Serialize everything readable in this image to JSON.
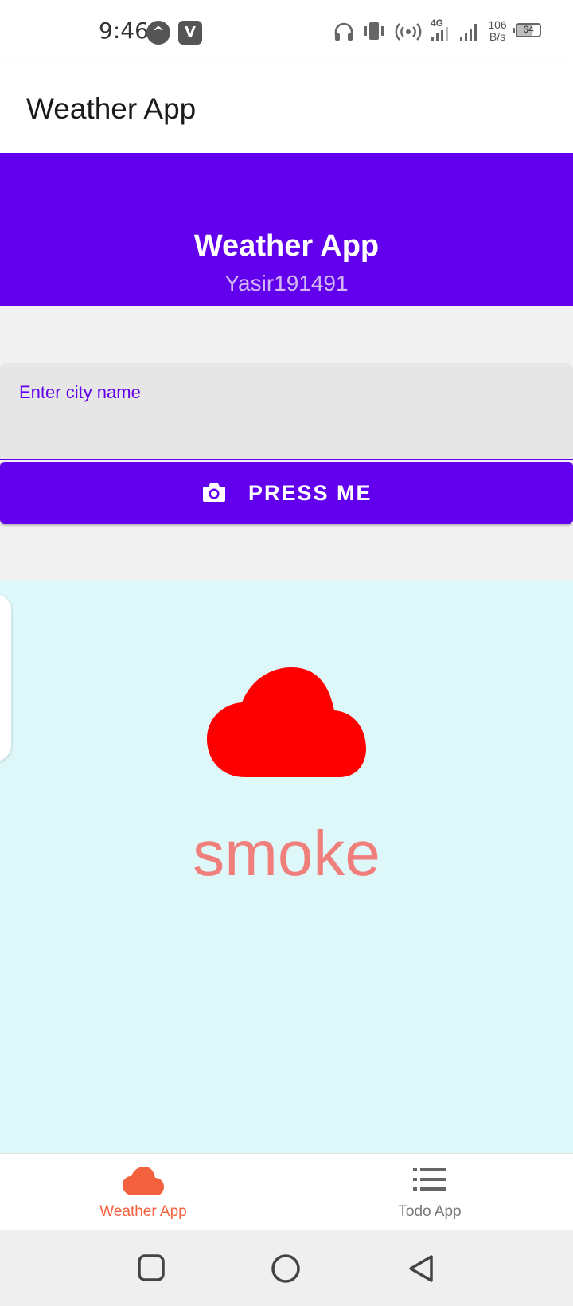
{
  "status_bar": {
    "time": "9:46",
    "app_icons": [
      "^",
      "V"
    ],
    "net_speed_value": "106",
    "net_speed_unit": "B/s",
    "network_type": "4G",
    "battery_level": "64",
    "icons": [
      "headphones-icon",
      "vibrate-icon",
      "hotspot-icon",
      "signal-4g-icon",
      "signal-icon",
      "battery-icon"
    ]
  },
  "app_bar": {
    "title": "Weather App"
  },
  "header": {
    "title": "Weather App",
    "subtitle": "Yasir191491",
    "background_color": "#6200ee"
  },
  "search": {
    "label": "Enter city name",
    "value": "",
    "accent_color": "#6200ee"
  },
  "action_button": {
    "icon": "camera-icon",
    "label": "PRESS ME",
    "color": "#6200ee"
  },
  "weather": {
    "icon": "cloud-icon",
    "icon_color": "#ff0000",
    "condition": "smoke",
    "text_color": "#f07f7b",
    "background_color": "#def7f9"
  },
  "bottom_nav": {
    "active_color": "#f4613f",
    "inactive_color": "#777777",
    "tabs": [
      {
        "label": "Weather App",
        "icon": "cloud-icon",
        "active": true
      },
      {
        "label": "Todo App",
        "icon": "list-icon",
        "active": false
      }
    ]
  },
  "system_nav": {
    "buttons": [
      "recent-apps",
      "home",
      "back"
    ]
  }
}
